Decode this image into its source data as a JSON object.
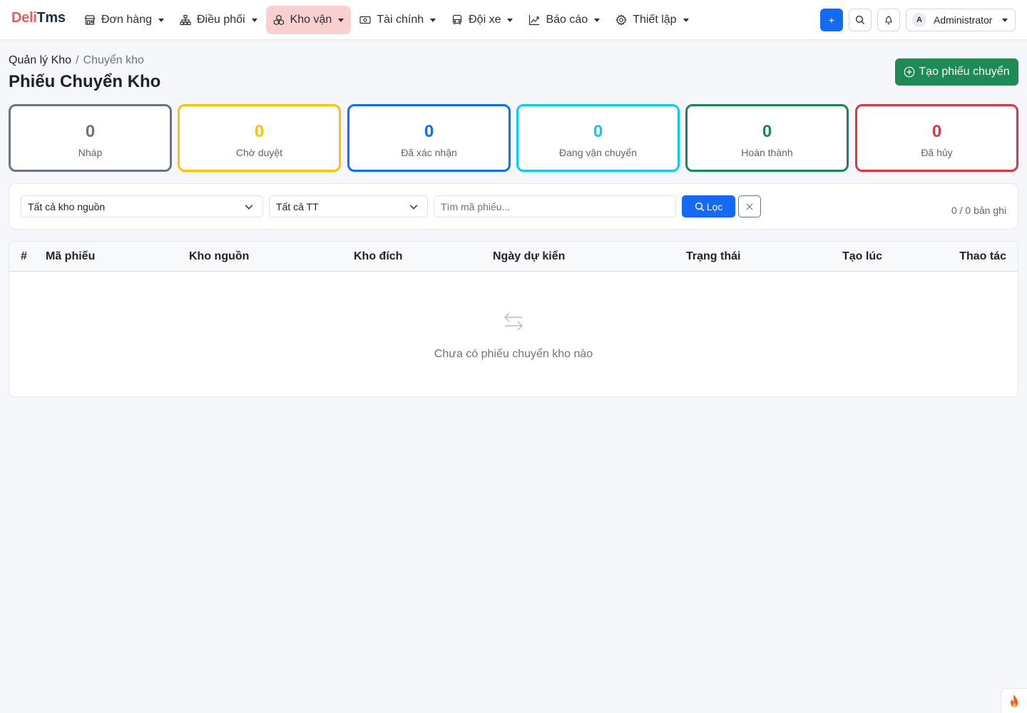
{
  "brand": {
    "part1": "Deli",
    "part2": "Tms"
  },
  "nav": {
    "items": [
      {
        "label": "Đơn hàng",
        "icon": "shop-icon"
      },
      {
        "label": "Điều phối",
        "icon": "diagram-icon"
      },
      {
        "label": "Kho vận",
        "icon": "boxes-icon",
        "active": true
      },
      {
        "label": "Tài chính",
        "icon": "cash-icon"
      },
      {
        "label": "Đội xe",
        "icon": "bus-icon"
      },
      {
        "label": "Báo cáo",
        "icon": "graph-up-icon"
      },
      {
        "label": "Thiết lập",
        "icon": "gear-icon"
      }
    ],
    "quick_add": "+",
    "user": {
      "initial": "A",
      "name": "Administrator"
    }
  },
  "breadcrumb": {
    "parent": "Quản lý Kho",
    "separator": "/",
    "current": "Chuyển kho"
  },
  "page": {
    "title": "Phiếu Chuyển Kho",
    "create_button": "Tạo phiếu chuyển"
  },
  "stats": [
    {
      "value": "0",
      "label": "Nháp",
      "color": "#6c757d"
    },
    {
      "value": "0",
      "label": "Chờ duyệt",
      "color": "#ffc107"
    },
    {
      "value": "0",
      "label": "Đã xác nhận",
      "color": "#0d6efd"
    },
    {
      "value": "0",
      "label": "Đang vận chuyển",
      "color": "#0dcaf0"
    },
    {
      "value": "0",
      "label": "Hoàn thành",
      "color": "#198754"
    },
    {
      "value": "0",
      "label": "Đã hủy",
      "color": "#dc3545"
    }
  ],
  "filters": {
    "source_warehouse": "Tất cả kho nguồn",
    "status": "Tất cả TT",
    "search_placeholder": "Tìm mã phiếu...",
    "filter_button": "Lọc",
    "record_count": "0 / 0 bản ghi"
  },
  "table": {
    "columns": [
      "#",
      "Mã phiếu",
      "Kho nguồn",
      "Kho đích",
      "Ngày dự kiến",
      "Trạng thái",
      "Tạo lúc",
      "Thao tác"
    ],
    "rows": [],
    "empty_text": "Chưa có phiếu chuyển kho nào"
  }
}
